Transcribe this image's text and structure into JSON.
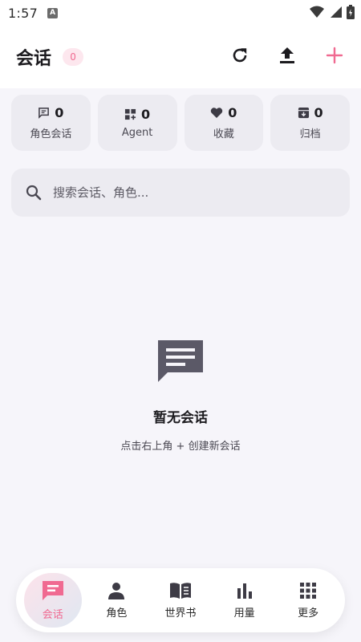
{
  "status_bar": {
    "time": "1:57",
    "badge_letter": "A"
  },
  "header": {
    "title": "会话",
    "count": "0"
  },
  "header_actions": [
    {
      "name": "refresh-icon"
    },
    {
      "name": "upload-icon"
    },
    {
      "name": "plus-icon",
      "color": "#f06a91"
    }
  ],
  "stats": [
    {
      "icon": "chat-icon",
      "value": "0",
      "label": "角色会话"
    },
    {
      "icon": "grid-plus-icon",
      "value": "0",
      "label": "Agent"
    },
    {
      "icon": "heart-icon",
      "value": "0",
      "label": "收藏"
    },
    {
      "icon": "archive-icon",
      "value": "0",
      "label": "归档"
    }
  ],
  "search": {
    "placeholder": "搜索会话、角色..."
  },
  "empty_state": {
    "icon": "chat-bubble-icon",
    "title": "暂无会话",
    "hint": "点击右上角 + 创建新会话"
  },
  "bottom_nav": [
    {
      "icon": "chat-icon",
      "label": "会话",
      "active": true
    },
    {
      "icon": "person-icon",
      "label": "角色",
      "active": false
    },
    {
      "icon": "book-icon",
      "label": "世界书",
      "active": false
    },
    {
      "icon": "bar-chart-icon",
      "label": "用量",
      "active": false
    },
    {
      "icon": "grid-icon",
      "label": "更多",
      "active": false
    }
  ],
  "colors": {
    "accent": "#f06a91",
    "card": "#ecebf1",
    "background": "#f6f5fa"
  }
}
